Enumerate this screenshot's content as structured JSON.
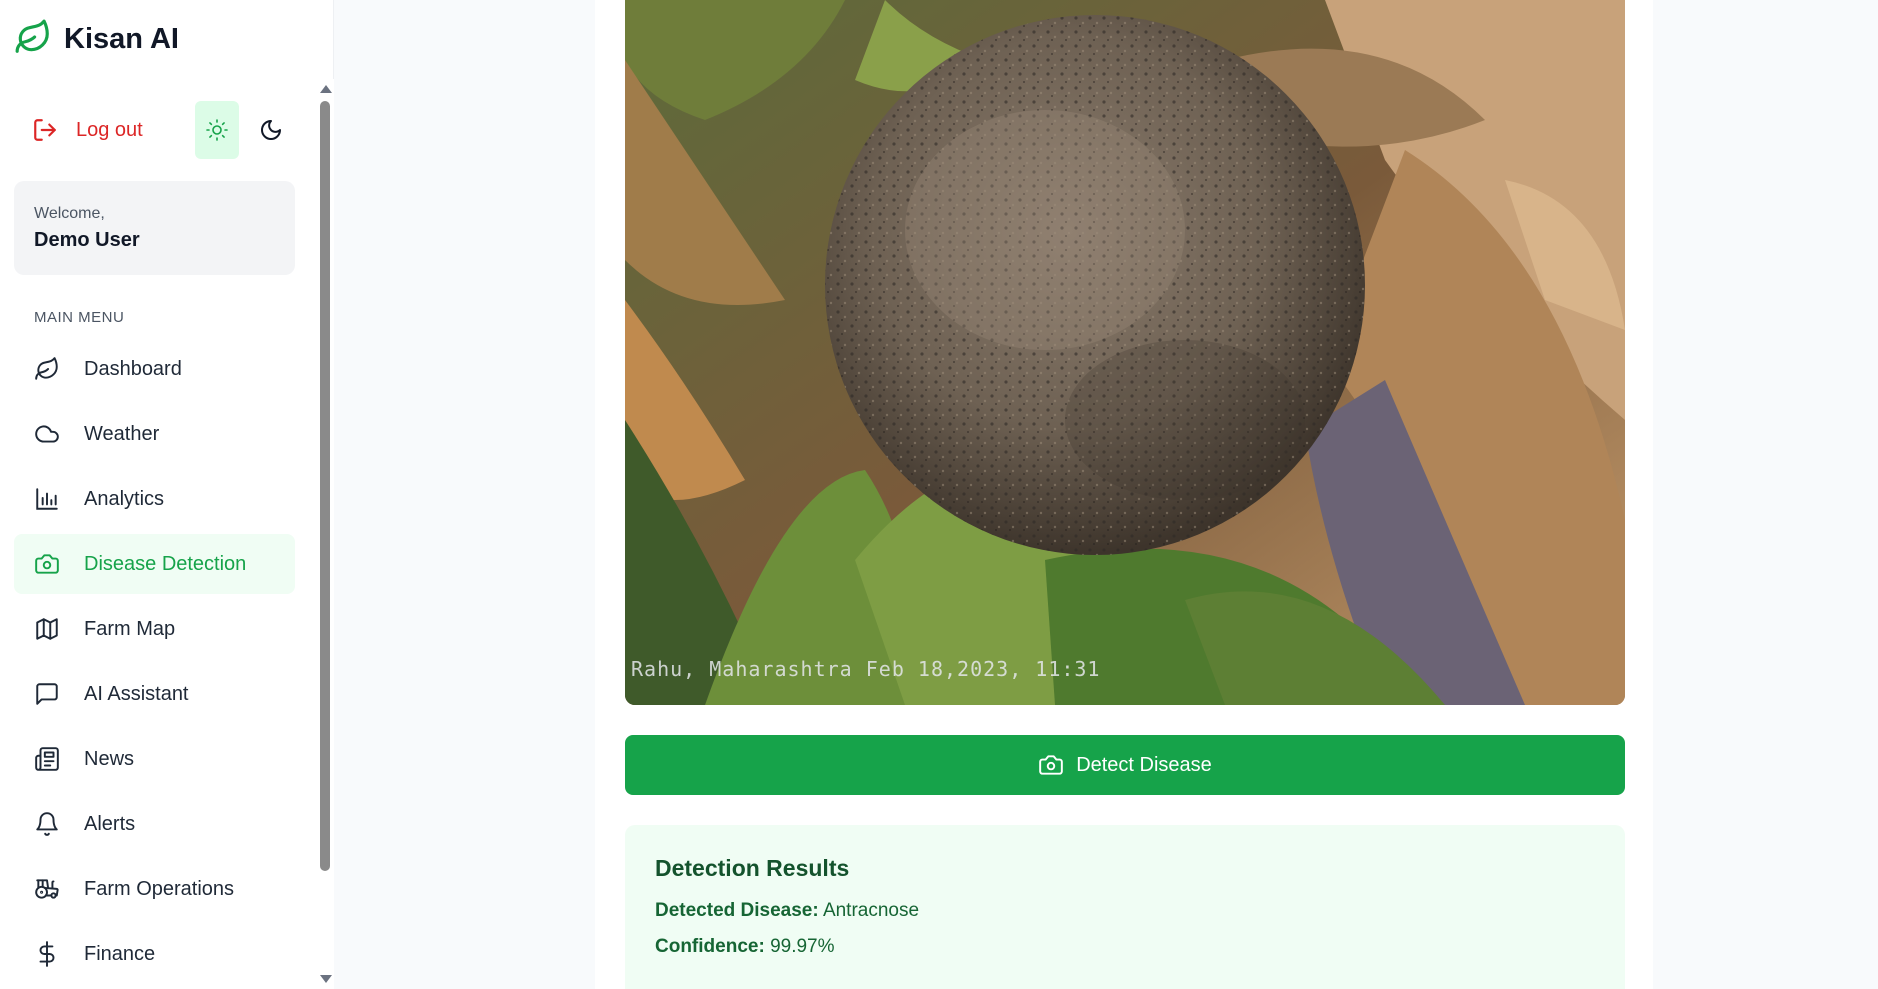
{
  "app": {
    "name": "Kisan AI"
  },
  "sidebar": {
    "logout_label": "Log out",
    "welcome_prefix": "Welcome,",
    "user_name": "Demo User",
    "menu_heading": "MAIN MENU",
    "items": [
      {
        "label": "Dashboard",
        "icon": "leaf-icon"
      },
      {
        "label": "Weather",
        "icon": "cloud-icon"
      },
      {
        "label": "Analytics",
        "icon": "bar-chart-icon"
      },
      {
        "label": "Disease Detection",
        "icon": "camera-icon",
        "active": true
      },
      {
        "label": "Farm Map",
        "icon": "map-icon"
      },
      {
        "label": "AI Assistant",
        "icon": "chat-icon"
      },
      {
        "label": "News",
        "icon": "newspaper-icon"
      },
      {
        "label": "Alerts",
        "icon": "bell-icon"
      },
      {
        "label": "Farm Operations",
        "icon": "tractor-icon"
      },
      {
        "label": "Finance",
        "icon": "dollar-icon"
      }
    ]
  },
  "main": {
    "photo_caption": "Rahu, Maharashtra Feb 18,2023, 11:31",
    "detect_button_label": "Detect Disease",
    "results": {
      "title": "Detection Results",
      "disease_key": "Detected Disease:",
      "disease_value": "Antracnose",
      "confidence_key": "Confidence:",
      "confidence_value": "99.97%"
    }
  },
  "colors": {
    "accent": "#16a34a",
    "danger": "#dc2626",
    "active_bg": "#f0fdf4"
  }
}
